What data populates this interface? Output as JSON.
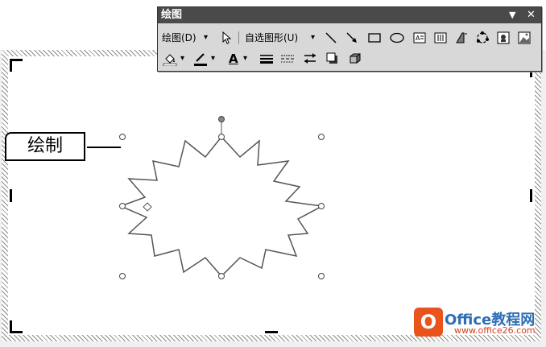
{
  "toolbar": {
    "title": "绘图",
    "dropdown_glyph": "▼",
    "close_glyph": "✕",
    "draw_menu_label": "绘图(D)",
    "autoshapes_label": "自选图形(U)",
    "dropdown_arrow": "▾",
    "icons_row1": [
      "select-arrow-icon",
      "line-icon",
      "arrow-icon",
      "rectangle-icon",
      "oval-icon",
      "text-box-icon",
      "vertical-text-box-icon",
      "wordart-icon",
      "diagram-icon",
      "clip-art-icon",
      "picture-icon"
    ],
    "icons_row2": [
      "fill-color-icon",
      "line-color-icon",
      "font-color-icon",
      "line-style-icon",
      "dash-style-icon",
      "arrow-style-icon",
      "shadow-style-icon",
      "3d-style-icon"
    ],
    "font_color_glyph": "A"
  },
  "callout": {
    "label": "绘制"
  },
  "watermark": {
    "logo_letter": "O",
    "text": "Office教程网",
    "url": "www.office26.com"
  },
  "colors": {
    "title_bar": "#4a4a4a",
    "toolbar_bg": "#d8d8d8",
    "watermark_orange": "#e8541c",
    "watermark_blue": "#2e6db4"
  }
}
